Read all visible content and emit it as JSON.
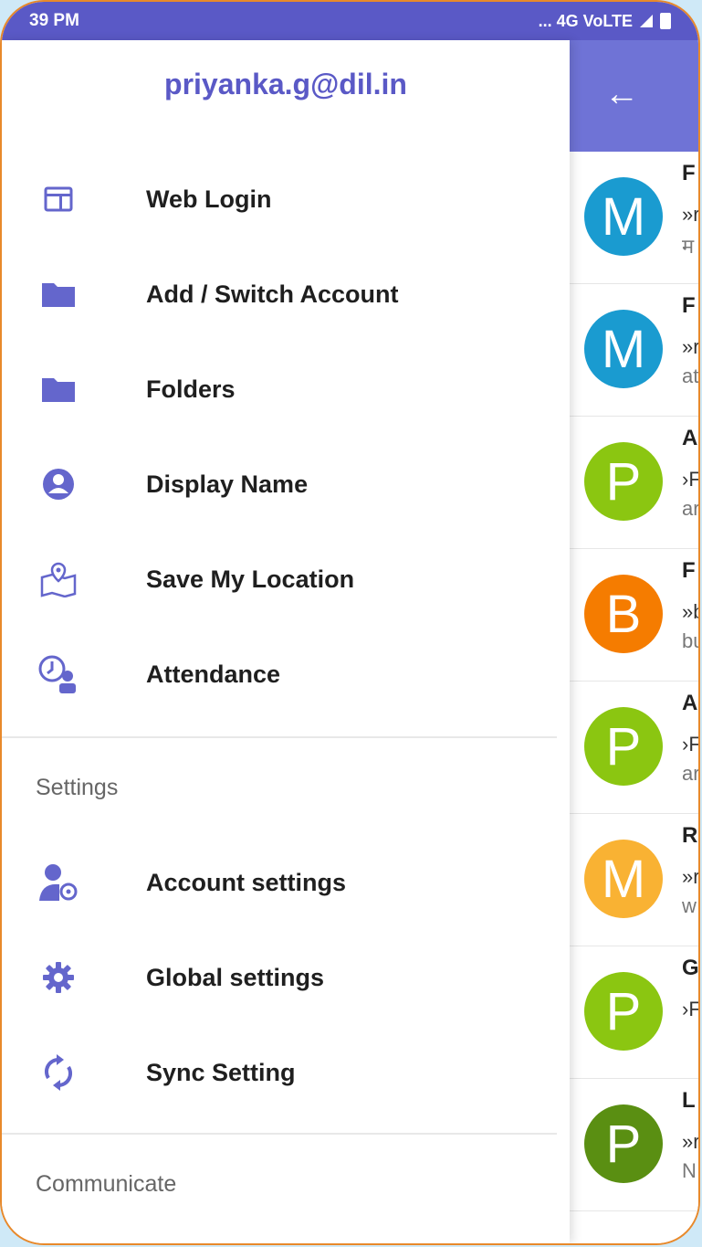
{
  "status": {
    "time": "39 PM",
    "right": "... 4G VoLTE"
  },
  "drawer": {
    "account_email": "priyanka.g@dil.in",
    "items": [
      {
        "label": "Web Login",
        "icon": "web-login-icon"
      },
      {
        "label": "Add / Switch Account",
        "icon": "folder-icon"
      },
      {
        "label": "Folders",
        "icon": "folder-icon"
      },
      {
        "label": "Display Name",
        "icon": "person-circle-icon"
      },
      {
        "label": "Save My Location",
        "icon": "map-location-icon"
      },
      {
        "label": "Attendance",
        "icon": "attendance-clock-icon"
      }
    ],
    "settings_header": "Settings",
    "settings_items": [
      {
        "label": "Account settings",
        "icon": "account-settings-icon"
      },
      {
        "label": "Global settings",
        "icon": "gear-icon"
      },
      {
        "label": "Sync Setting",
        "icon": "sync-icon"
      }
    ],
    "communicate_header": "Communicate"
  },
  "mail_list": [
    {
      "letter": "M",
      "color": "#1a9bd0",
      "l1": "F",
      "l2": "»r",
      "l3": "म"
    },
    {
      "letter": "M",
      "color": "#1a9bd0",
      "l1": "F",
      "l2": "»r",
      "l3": "at"
    },
    {
      "letter": "P",
      "color": "#8bc611",
      "l1": "A",
      "l2": "›F",
      "l3": "ar"
    },
    {
      "letter": "B",
      "color": "#f57c00",
      "l1": "F",
      "l2": "»b",
      "l3": "bu"
    },
    {
      "letter": "P",
      "color": "#8bc611",
      "l1": "A",
      "l2": "›F",
      "l3": "ar"
    },
    {
      "letter": "M",
      "color": "#f9b233",
      "l1": "R",
      "l2": "»r",
      "l3": "w"
    },
    {
      "letter": "P",
      "color": "#8bc611",
      "l1": "G",
      "l2": "›F",
      "l3": ""
    },
    {
      "letter": "P",
      "color": "#5a8f12",
      "l1": "L",
      "l2": "»r",
      "l3": "N"
    }
  ],
  "colors": {
    "accent": "#5a59c6",
    "toolbar": "#6f73d6",
    "frame": "#e8892b"
  }
}
